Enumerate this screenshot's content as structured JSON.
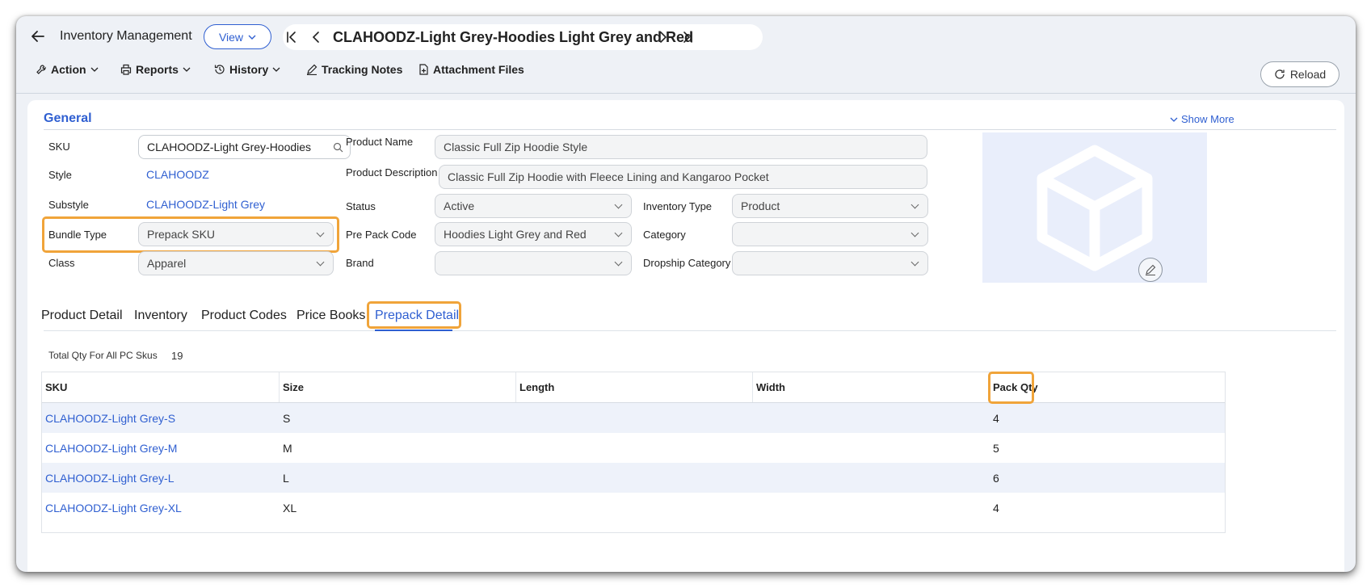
{
  "header": {
    "app_title": "Inventory Management",
    "view_label": "View",
    "record_title": "CLAHOODZ-Light Grey-Hoodies Light Grey and Red"
  },
  "toolbar": {
    "action": "Action",
    "reports": "Reports",
    "history": "History",
    "tracking_notes": "Tracking Notes",
    "attachment_files": "Attachment Files",
    "reload": "Reload"
  },
  "general": {
    "title": "General",
    "show_more": "Show More",
    "fields": {
      "sku_label": "SKU",
      "sku_value": "CLAHOODZ-Light Grey-Hoodies",
      "style_label": "Style",
      "style_value": "CLAHOODZ",
      "substyle_label": "Substyle",
      "substyle_value": "CLAHOODZ-Light Grey",
      "bundle_type_label": "Bundle Type",
      "bundle_type_value": "Prepack SKU",
      "class_label": "Class",
      "class_value": "Apparel",
      "product_name_label": "Product Name",
      "product_name_value": "Classic Full Zip Hoodie Style",
      "product_description_label": "Product Description",
      "product_description_value": "Classic Full Zip Hoodie with Fleece Lining and Kangaroo Pocket",
      "status_label": "Status",
      "status_value": "Active",
      "pre_pack_code_label": "Pre Pack Code",
      "pre_pack_code_value": "Hoodies Light Grey and Red",
      "brand_label": "Brand",
      "brand_value": "",
      "inventory_type_label": "Inventory Type",
      "inventory_type_value": "Product",
      "category_label": "Category",
      "category_value": "",
      "dropship_category_label": "Dropship Category",
      "dropship_category_value": ""
    }
  },
  "tabs": [
    {
      "label": "Product Detail"
    },
    {
      "label": "Inventory"
    },
    {
      "label": "Product Codes"
    },
    {
      "label": "Price Books"
    },
    {
      "label": "Prepack Detail"
    }
  ],
  "active_tab": "Prepack Detail",
  "prepack": {
    "total_label": "Total Qty For All PC Skus",
    "total_value": "19",
    "columns": [
      "SKU",
      "Size",
      "Length",
      "Width",
      "Pack Qty"
    ],
    "rows": [
      {
        "sku": "CLAHOODZ-Light Grey-S",
        "size": "S",
        "length": "",
        "width": "",
        "pack_qty": "4"
      },
      {
        "sku": "CLAHOODZ-Light Grey-M",
        "size": "M",
        "length": "",
        "width": "",
        "pack_qty": "5"
      },
      {
        "sku": "CLAHOODZ-Light Grey-L",
        "size": "L",
        "length": "",
        "width": "",
        "pack_qty": "6"
      },
      {
        "sku": "CLAHOODZ-Light Grey-XL",
        "size": "XL",
        "length": "",
        "width": "",
        "pack_qty": "4"
      }
    ]
  },
  "colors": {
    "accent": "#2f5fd1",
    "highlight": "#f0a43a",
    "row_alt": "#eef2fa"
  }
}
